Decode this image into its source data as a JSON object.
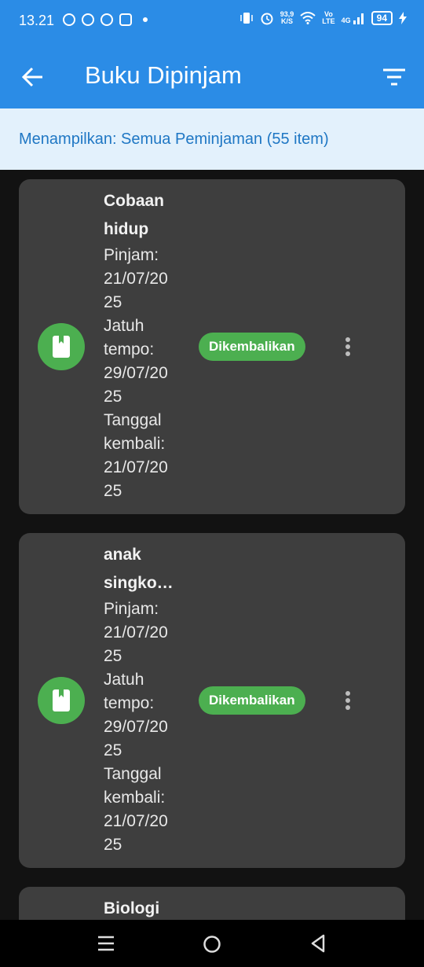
{
  "status_bar": {
    "time": "13.21",
    "net_speed": "93,9",
    "net_unit": "K/S",
    "volte_top": "Vo",
    "volte_bottom": "LTE",
    "network": "4G",
    "battery": "94"
  },
  "app_bar": {
    "title": "Buku Dipinjam",
    "back_icon": "arrow-left-icon",
    "filter_icon": "filter-icon"
  },
  "filter_info": "Menampilkan: Semua Peminjaman (55 item)",
  "loans": [
    {
      "title_line1": "Cobaan",
      "title_line2": "hidup",
      "borrow_label": "Pinjam:",
      "borrow_line1": "21/07/20",
      "borrow_line2": "25",
      "due_label1": "Jatuh",
      "due_label2": "tempo:",
      "due_line1": "29/07/20",
      "due_line2": "25",
      "return_label1": "Tanggal",
      "return_label2": "kembali:",
      "return_line1": "21/07/20",
      "return_line2": "25",
      "status": "Dikembalikan"
    },
    {
      "title_line1": "anak",
      "title_line2": "singko…",
      "borrow_label": "Pinjam:",
      "borrow_line1": "21/07/20",
      "borrow_line2": "25",
      "due_label1": "Jatuh",
      "due_label2": "tempo:",
      "due_line1": "29/07/20",
      "due_line2": "25",
      "return_label1": "Tanggal",
      "return_label2": "kembali:",
      "return_line1": "21/07/20",
      "return_line2": "25",
      "status": "Dikembalikan"
    },
    {
      "title_line1": "Biologi"
    }
  ],
  "colors": {
    "primary": "#2b8ce6",
    "banner_bg": "#e3f1fc",
    "banner_text": "#1f77c4",
    "card_bg": "#3e3e3e",
    "status_green": "#4caf50",
    "background": "#121212"
  },
  "nav_icons": [
    "menu-icon",
    "home-icon",
    "back-triangle-icon"
  ]
}
